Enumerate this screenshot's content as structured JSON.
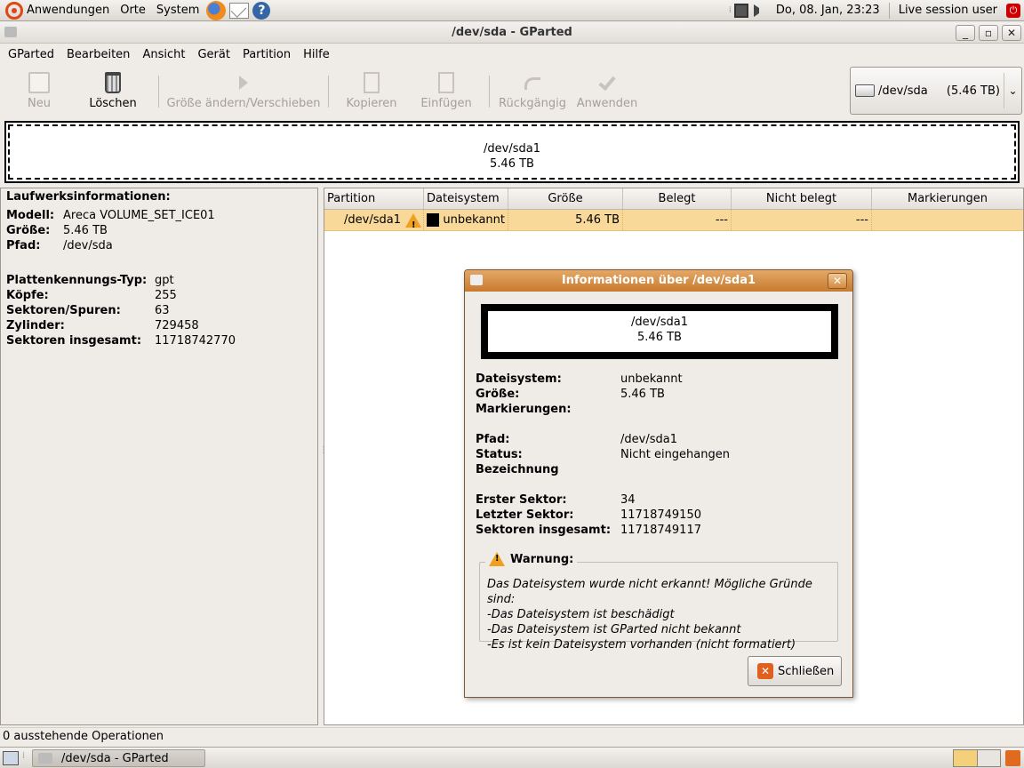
{
  "top_panel": {
    "applications": "Anwendungen",
    "places": "Orte",
    "system": "System",
    "datetime": "Do, 08. Jan, 23:23",
    "user": "Live session user"
  },
  "window": {
    "title": "/dev/sda - GParted",
    "minimize": "_",
    "maximize": "▫",
    "close": "✕"
  },
  "menu": {
    "items": [
      "GParted",
      "Bearbeiten",
      "Ansicht",
      "Gerät",
      "Partition",
      "Hilfe"
    ]
  },
  "toolbar": {
    "new": "Neu",
    "delete": "Löschen",
    "resize": "Größe ändern/Verschieben",
    "copy": "Kopieren",
    "paste": "Einfügen",
    "undo": "Rückgängig",
    "apply": "Anwenden"
  },
  "device_combo": {
    "device": "/dev/sda",
    "size": "(5.46 TB)",
    "arrow": "⌄"
  },
  "disk_graphic": {
    "partition": "/dev/sda1",
    "size": "5.46 TB"
  },
  "drive_info": {
    "title": "Laufwerksinformationen:",
    "group1": [
      {
        "k": "Modell:",
        "v": "Areca VOLUME_SET_ICE01"
      },
      {
        "k": "Größe:",
        "v": "5.46 TB"
      },
      {
        "k": "Pfad:",
        "v": "/dev/sda"
      }
    ],
    "group2": [
      {
        "k": "Plattenkennungs-Typ:",
        "v": "gpt"
      },
      {
        "k": "Köpfe:",
        "v": "255"
      },
      {
        "k": "Sektoren/Spuren:",
        "v": "63"
      },
      {
        "k": "Zylinder:",
        "v": "729458"
      },
      {
        "k": "Sektoren insgesamt:",
        "v": "11718742770"
      }
    ]
  },
  "partition_table": {
    "headers": [
      "Partition",
      "Dateisystem",
      "Größe",
      "Belegt",
      "Nicht belegt",
      "Markierungen"
    ],
    "rows": [
      {
        "partition": "/dev/sda1",
        "filesystem": "unbekannt",
        "size": "5.46 TB",
        "used": "---",
        "unused": "---",
        "flags": ""
      }
    ]
  },
  "dialog": {
    "title": "Informationen über /dev/sda1",
    "close_x": "✕",
    "graphic_partition": "/dev/sda1",
    "graphic_size": "5.46 TB",
    "group1": [
      {
        "k": "Dateisystem:",
        "v": "unbekannt"
      },
      {
        "k": "Größe:",
        "v": "5.46 TB"
      },
      {
        "k": "Markierungen:",
        "v": ""
      }
    ],
    "group2": [
      {
        "k": "Pfad:",
        "v": "/dev/sda1"
      },
      {
        "k": "Status:",
        "v": "Nicht eingehangen"
      },
      {
        "k": "Bezeichnung",
        "v": ""
      }
    ],
    "group3": [
      {
        "k": "Erster Sektor:",
        "v": "34"
      },
      {
        "k": "Letzter Sektor:",
        "v": "11718749150"
      },
      {
        "k": "Sektoren insgesamt:",
        "v": "11718749117"
      }
    ],
    "warning_title": "Warnung:",
    "warning_lines": [
      "Das Dateisystem wurde nicht erkannt! Mögliche Gründe sind:",
      "-Das Dateisystem ist beschädigt",
      "-Das Dateisystem ist GParted nicht bekannt",
      "-Es ist kein Dateisystem vorhanden (nicht formatiert)"
    ],
    "close_button": "Schließen"
  },
  "status": {
    "pending": "0 ausstehende Operationen"
  },
  "taskbar": {
    "window_button": "/dev/sda - GParted"
  },
  "colors": {
    "selection": "#f9d999",
    "dialog_title": "#c77a2f",
    "warning": "#f0a020"
  }
}
